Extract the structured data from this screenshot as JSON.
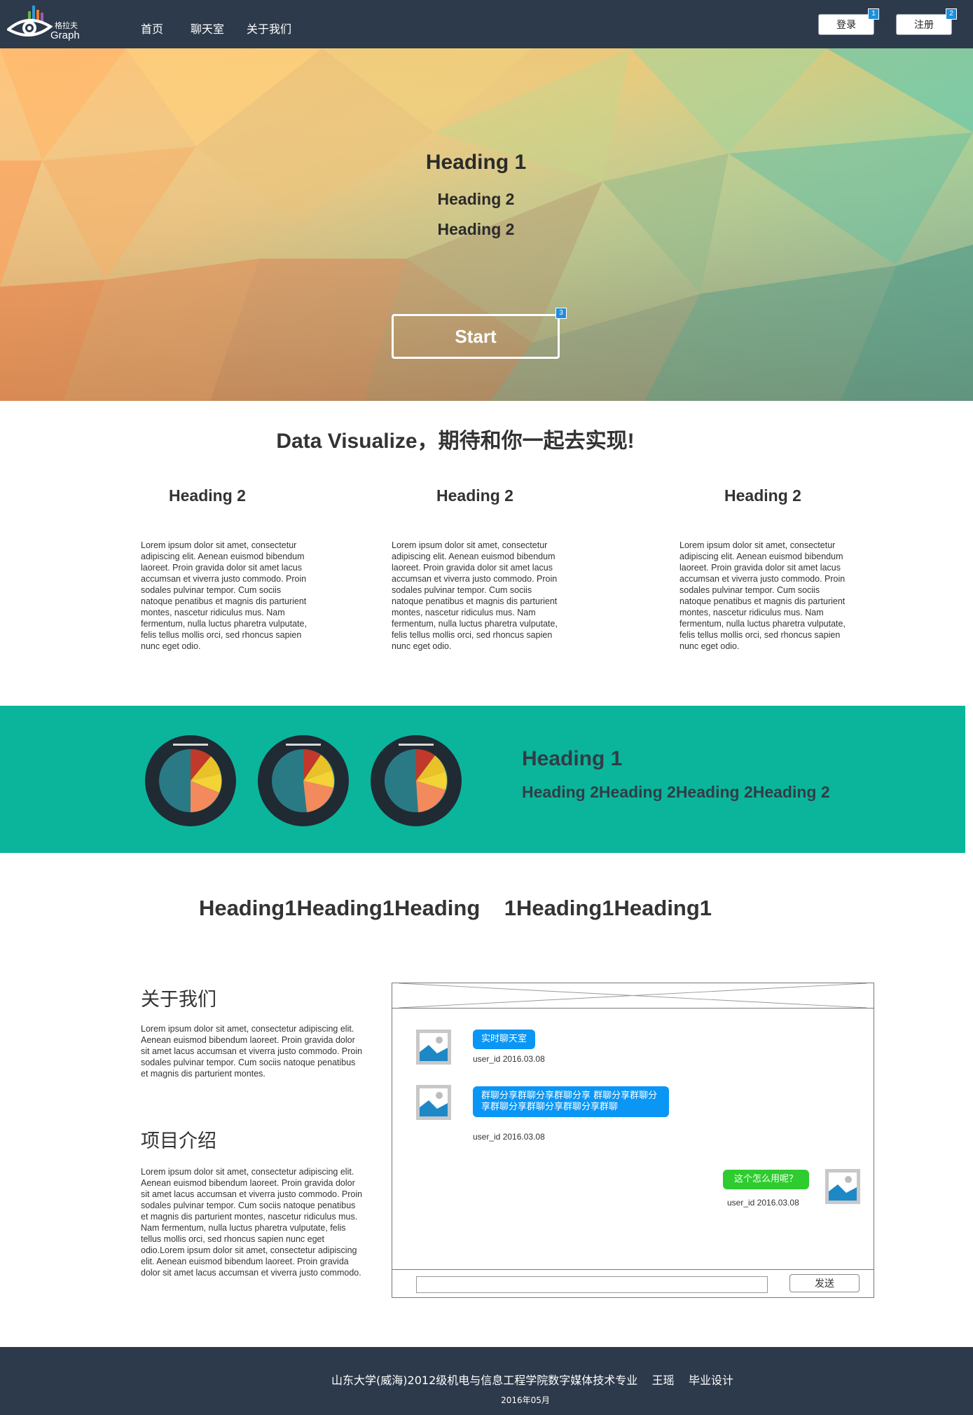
{
  "nav": {
    "logo_cn": "格拉夫",
    "logo_en": "Graph",
    "links": [
      "首页",
      "聊天室",
      "关于我们"
    ],
    "login_label": "登录",
    "login_badge": "1",
    "register_label": "注册",
    "register_badge": "2"
  },
  "hero": {
    "heading1": "Heading 1",
    "heading2a": "Heading 2",
    "heading2b": "Heading 2",
    "start_label": "Start",
    "start_badge": "3"
  },
  "intro": {
    "title": "Data Visualize，期待和你一起去实现!",
    "features": [
      {
        "heading": "Heading 2",
        "text": "Lorem ipsum dolor sit amet, consectetur adipiscing elit. Aenean euismod bibendum laoreet. Proin gravida dolor sit amet lacus accumsan et viverra justo commodo. Proin sodales pulvinar tempor. Cum sociis natoque penatibus et magnis dis parturient montes, nascetur ridiculus mus. Nam fermentum, nulla luctus pharetra vulputate, felis tellus mollis orci, sed rhoncus sapien nunc eget odio."
      },
      {
        "heading": "Heading 2",
        "text": "Lorem ipsum dolor sit amet, consectetur adipiscing elit. Aenean euismod bibendum laoreet. Proin gravida dolor sit amet lacus accumsan et viverra justo commodo. Proin sodales pulvinar tempor. Cum sociis natoque penatibus et magnis dis parturient montes, nascetur ridiculus mus. Nam fermentum, nulla luctus pharetra vulputate, felis tellus mollis orci, sed rhoncus sapien nunc eget odio."
      },
      {
        "heading": "Heading 2",
        "text": "Lorem ipsum dolor sit amet, consectetur adipiscing elit. Aenean euismod bibendum laoreet. Proin gravida dolor sit amet lacus accumsan et viverra justo commodo. Proin sodales pulvinar tempor. Cum sociis natoque penatibus et magnis dis parturient montes, nascetur ridiculus mus. Nam fermentum, nulla luctus pharetra vulputate, felis tellus mollis orci, sed rhoncus sapien nunc eget odio."
      }
    ]
  },
  "band": {
    "heading1": "Heading 1",
    "heading2": "Heading 2Heading 2Heading 2Heading 2"
  },
  "big_heading": "Heading1Heading1Heading    1Heading1Heading1",
  "about": {
    "title": "关于我们",
    "text": "Lorem ipsum dolor sit amet, consectetur adipiscing elit. Aenean euismod bibendum laoreet. Proin gravida dolor sit amet lacus accumsan et viverra justo commodo. Proin sodales pulvinar tempor. Cum sociis natoque penatibus et magnis dis parturient montes.",
    "project_title": "项目介绍",
    "project_text": "Lorem ipsum dolor sit amet, consectetur adipiscing elit. Aenean euismod bibendum laoreet. Proin gravida dolor sit amet lacus accumsan et viverra justo commodo. Proin sodales pulvinar tempor. Cum sociis natoque penatibus et magnis dis parturient montes, nascetur ridiculus mus. Nam fermentum, nulla luctus pharetra vulputate, felis tellus mollis orci, sed rhoncus sapien nunc eget odio.Lorem ipsum dolor sit amet, consectetur adipiscing elit. Aenean euismod bibendum laoreet. Proin gravida dolor sit amet lacus accumsan et viverra justo commodo."
  },
  "chat": {
    "messages": [
      {
        "text": "实时聊天室",
        "meta": "user_id  2016.03.08"
      },
      {
        "text": "群聊分享群聊分享群聊分享  群聊分享群聊分享群聊分享群聊分享群聊分享群聊",
        "meta": "user_id  2016.03.08"
      },
      {
        "text": "这个怎么用呢？",
        "meta": "user_id  2016.03.08"
      }
    ],
    "input_value": "",
    "send_label": "发送"
  },
  "footer": {
    "main": "山东大学(威海)2012级机电与信息工程学院数字媒体技术专业    王瑶    毕业设计",
    "date": "2016年05月"
  },
  "colors": {
    "nav_bg": "#2d3a4b",
    "teal": "#0bb59b",
    "bubble_blue": "#0a96f5",
    "bubble_green": "#2ecc2e",
    "badge_blue": "#1e8fdc"
  }
}
